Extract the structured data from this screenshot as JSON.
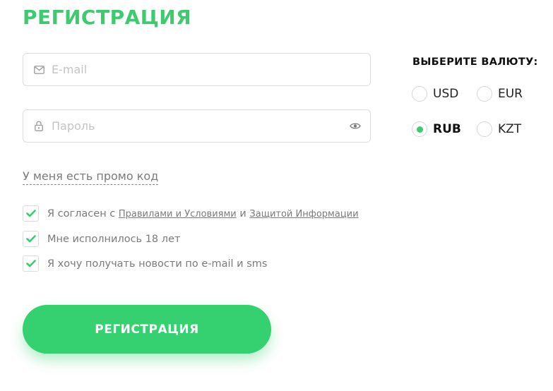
{
  "form": {
    "title": "РЕГИСТРАЦИЯ",
    "email": {
      "placeholder": "E-mail",
      "value": ""
    },
    "password": {
      "placeholder": "Пароль",
      "value": ""
    },
    "promo_link": "У меня есть промо код",
    "agreements": [
      {
        "text_before": "Я согласен с",
        "link1": "Правилами и Условиями",
        "joiner": "и",
        "link2": "Защитой Информации",
        "checked": true
      },
      {
        "text": "Мне исполнилось 18 лет",
        "checked": true
      },
      {
        "text": "Я хочу получать новости по e-mail и sms",
        "checked": true
      }
    ],
    "submit_label": "РЕГИСТРАЦИЯ"
  },
  "currency": {
    "title": "ВЫБЕРИТЕ ВАЛЮТУ:",
    "options": [
      "USD",
      "EUR",
      "RUB",
      "KZT"
    ],
    "selected": "RUB"
  },
  "colors": {
    "accent": "#3ecb6f",
    "button": "#35d070"
  },
  "icons": {
    "email": "envelope-icon",
    "password": "lock-icon",
    "toggle_password": "eye-icon",
    "checkbox": "checkmark-icon"
  }
}
